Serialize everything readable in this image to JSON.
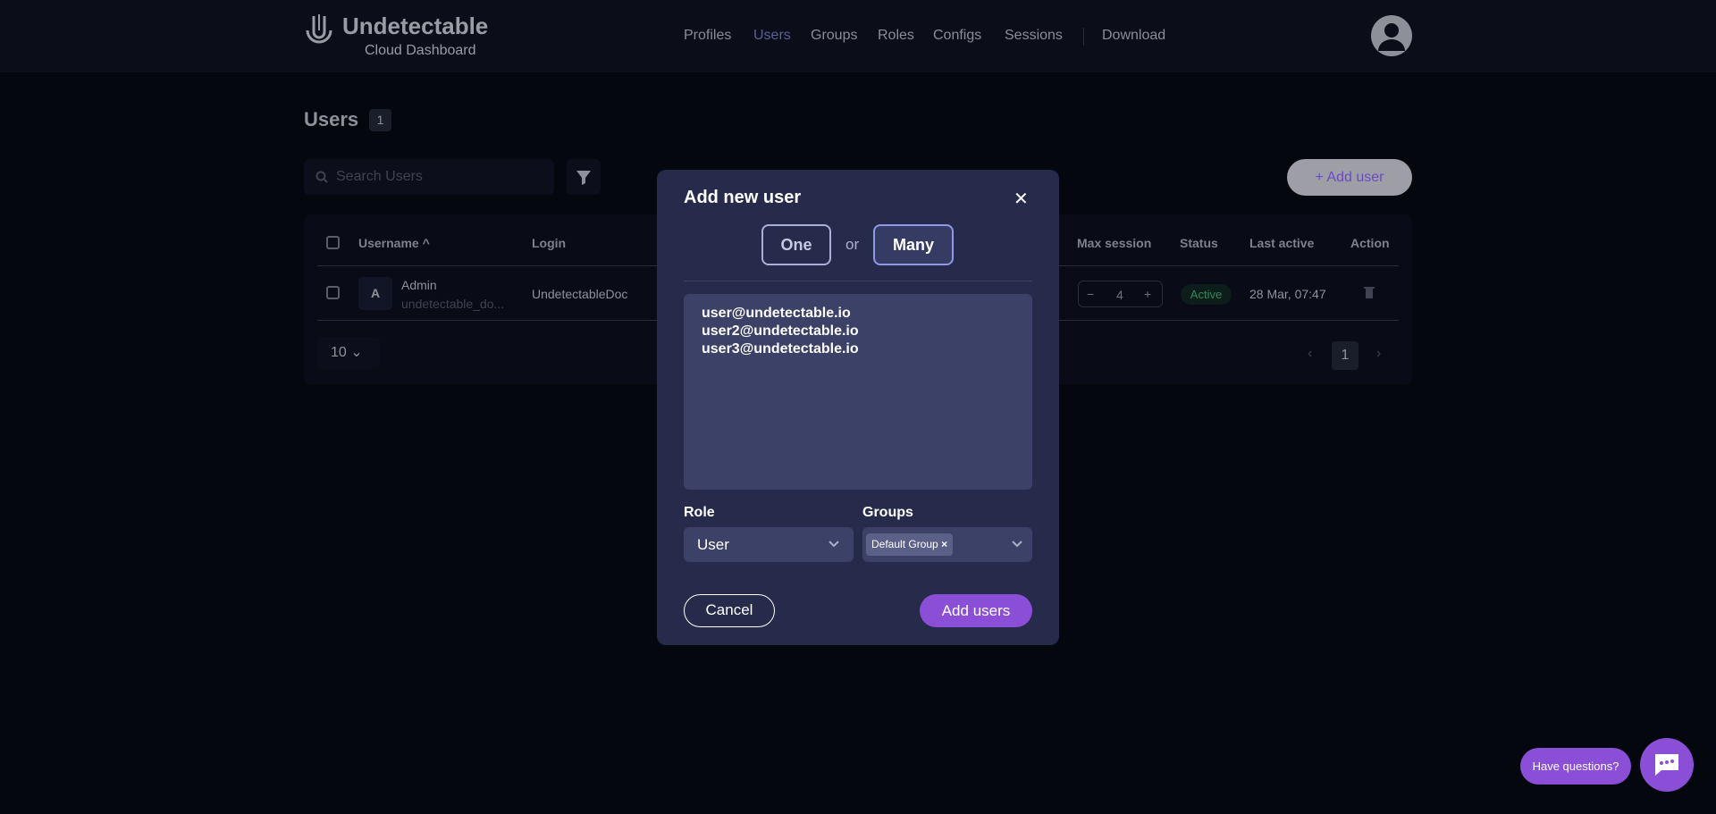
{
  "header": {
    "brand": "Undetectable",
    "subtitle": "Cloud Dashboard",
    "nav": [
      "Profiles",
      "Users",
      "Groups",
      "Roles",
      "Configs",
      "Sessions"
    ],
    "active_nav": "Users",
    "download": "Download"
  },
  "page": {
    "title": "Users",
    "count": "1",
    "search_placeholder": "Search Users",
    "add_user": "Add user"
  },
  "table": {
    "columns": [
      "Username",
      "Login",
      "Max session",
      "Status",
      "Last active",
      "Action"
    ],
    "rows": [
      {
        "avatar": "A",
        "name": "Admin",
        "email": "undetectable_do...",
        "login": "UndetectableDoc",
        "max_session": "4",
        "status": "Active",
        "last_active": "28 Mar, 07:47"
      }
    ],
    "page_size": "10",
    "current_page": "1"
  },
  "modal": {
    "title": "Add new user",
    "one": "One",
    "or": "or",
    "many": "Many",
    "selected_mode": "Many",
    "users_text": "user@undetectable.io\nuser2@undetectable.io\nuser3@undetectable.io",
    "role_label": "Role",
    "role_value": "User",
    "groups_label": "Groups",
    "group_tag": "Default Group",
    "cancel": "Cancel",
    "submit": "Add users"
  },
  "chat": {
    "label": "Have questions?"
  },
  "colors": {
    "accent": "#8a4fd6",
    "modal_bg": "#262b4b",
    "active_status": "#2e8a5a"
  }
}
